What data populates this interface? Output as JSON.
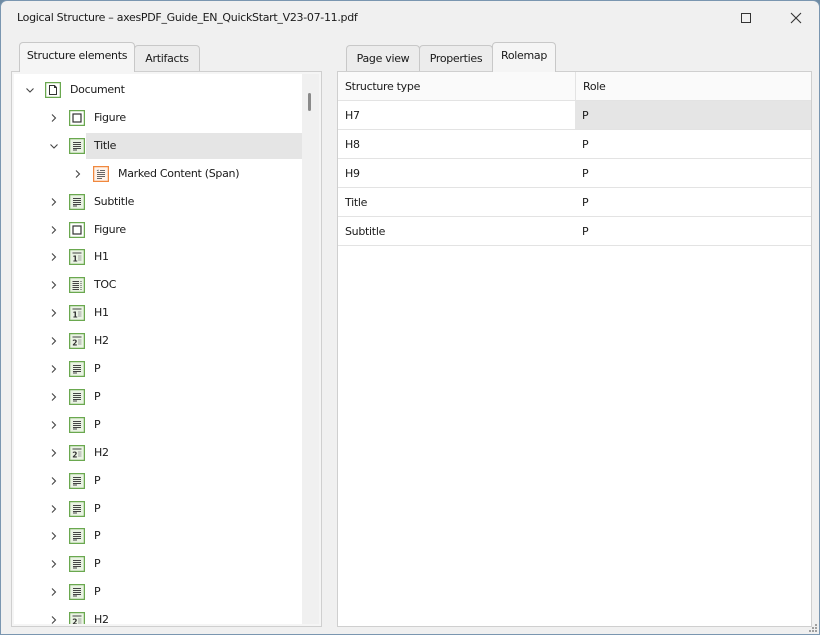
{
  "window": {
    "title": "Logical Structure – axesPDF_Guide_EN_QuickStart_V23-07-11.pdf",
    "maximize_icon": "maximize-icon",
    "close_icon": "close-icon"
  },
  "left_tabs": [
    {
      "label": "Structure elements",
      "active": true
    },
    {
      "label": "Artifacts",
      "active": false
    }
  ],
  "right_tabs": [
    {
      "label": "Page view",
      "active": false
    },
    {
      "label": "Properties",
      "active": false
    },
    {
      "label": "Rolemap",
      "active": true
    }
  ],
  "tree": {
    "nodes": [
      {
        "label": "Document",
        "level": 0,
        "expanded": true,
        "icon": "document-icon",
        "selected": false
      },
      {
        "label": "Figure",
        "level": 1,
        "expanded": false,
        "icon": "figure-icon",
        "selected": false
      },
      {
        "label": "Title",
        "level": 1,
        "expanded": true,
        "icon": "paragraph-icon",
        "selected": true
      },
      {
        "label": "Marked Content (Span)",
        "level": 2,
        "expanded": false,
        "icon": "marked-content-icon",
        "selected": false
      },
      {
        "label": "Subtitle",
        "level": 1,
        "expanded": false,
        "icon": "paragraph-icon",
        "selected": false
      },
      {
        "label": "Figure",
        "level": 1,
        "expanded": false,
        "icon": "figure-icon",
        "selected": false
      },
      {
        "label": "H1",
        "level": 1,
        "expanded": false,
        "icon": "heading-1-icon",
        "selected": false
      },
      {
        "label": "TOC",
        "level": 1,
        "expanded": false,
        "icon": "toc-icon",
        "selected": false
      },
      {
        "label": "H1",
        "level": 1,
        "expanded": false,
        "icon": "heading-1-icon",
        "selected": false
      },
      {
        "label": "H2",
        "level": 1,
        "expanded": false,
        "icon": "heading-2-icon",
        "selected": false
      },
      {
        "label": "P",
        "level": 1,
        "expanded": false,
        "icon": "paragraph-icon",
        "selected": false
      },
      {
        "label": "P",
        "level": 1,
        "expanded": false,
        "icon": "paragraph-icon",
        "selected": false
      },
      {
        "label": "P",
        "level": 1,
        "expanded": false,
        "icon": "paragraph-icon",
        "selected": false
      },
      {
        "label": "H2",
        "level": 1,
        "expanded": false,
        "icon": "heading-2-icon",
        "selected": false
      },
      {
        "label": "P",
        "level": 1,
        "expanded": false,
        "icon": "paragraph-icon",
        "selected": false
      },
      {
        "label": "P",
        "level": 1,
        "expanded": false,
        "icon": "paragraph-icon",
        "selected": false
      },
      {
        "label": "P",
        "level": 1,
        "expanded": false,
        "icon": "paragraph-icon",
        "selected": false
      },
      {
        "label": "P",
        "level": 1,
        "expanded": false,
        "icon": "paragraph-icon",
        "selected": false
      },
      {
        "label": "P",
        "level": 1,
        "expanded": false,
        "icon": "paragraph-icon",
        "selected": false
      },
      {
        "label": "H2",
        "level": 1,
        "expanded": false,
        "icon": "heading-2-icon",
        "selected": false
      }
    ]
  },
  "rolemap": {
    "columns": [
      "Structure type",
      "Role"
    ],
    "rows": [
      {
        "structure_type": "H7",
        "role": "P",
        "selected": true
      },
      {
        "structure_type": "H8",
        "role": "P",
        "selected": false
      },
      {
        "structure_type": "H9",
        "role": "P",
        "selected": false
      },
      {
        "structure_type": "Title",
        "role": "P",
        "selected": false
      },
      {
        "structure_type": "Subtitle",
        "role": "P",
        "selected": false
      }
    ]
  },
  "colors": {
    "struct_icon_green": "#6aa84f",
    "marked_content_orange": "#f0883e",
    "selection_gray": "#e5e5e5"
  }
}
